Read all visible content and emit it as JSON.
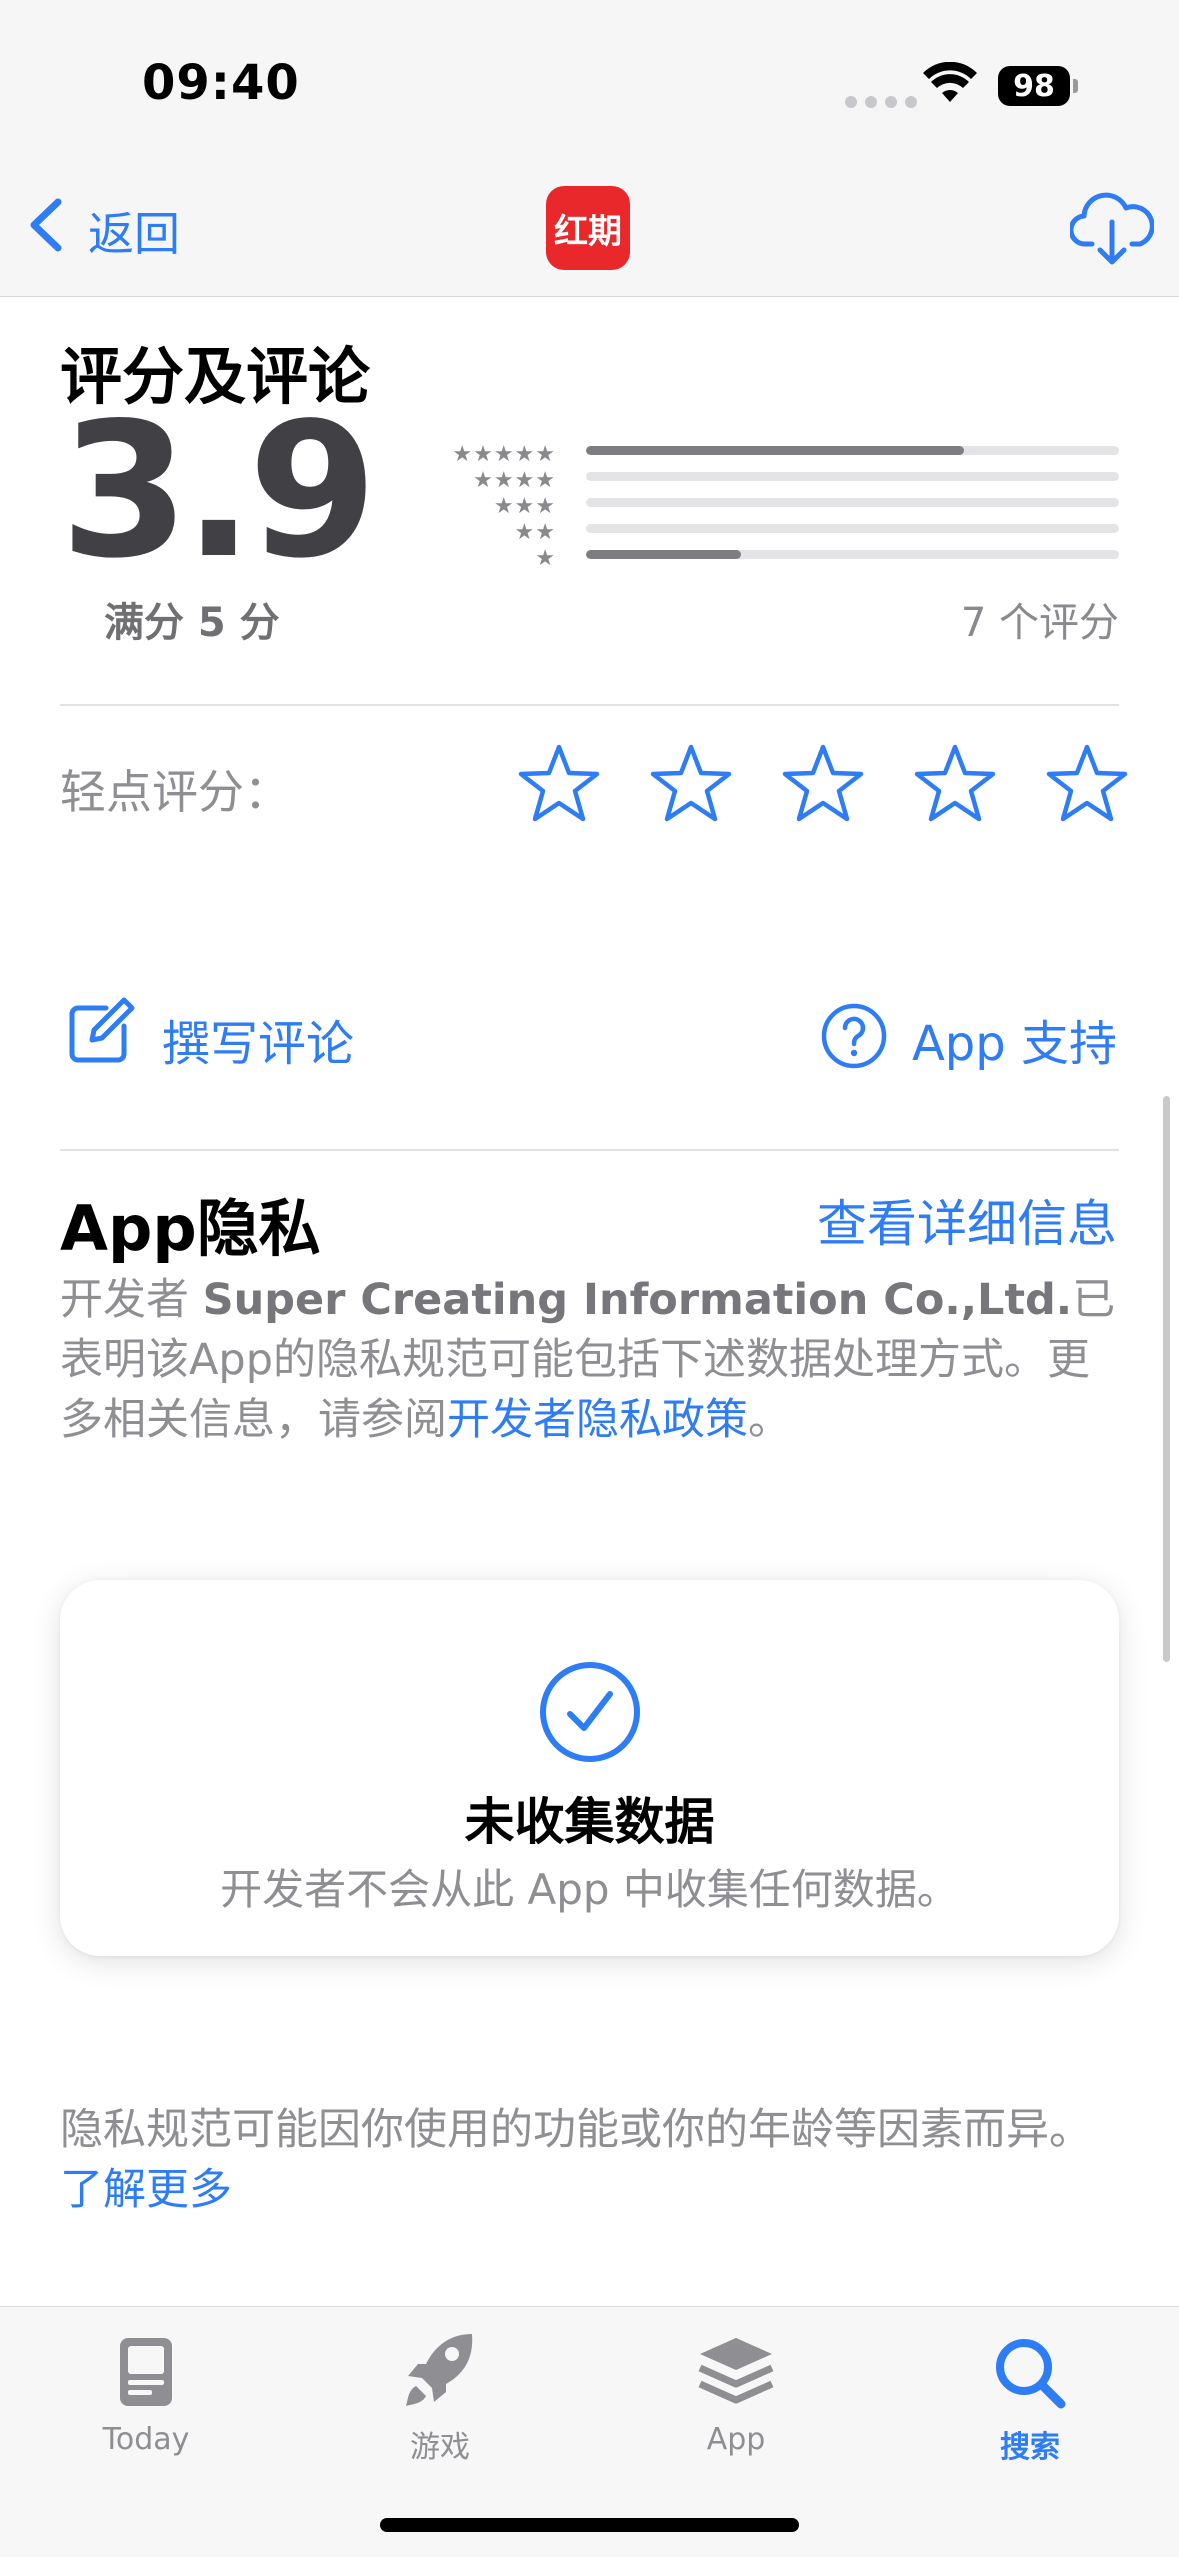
{
  "status": {
    "time": "09:40",
    "battery": "98"
  },
  "nav": {
    "back_label": "返回",
    "app_icon_text": "红期"
  },
  "ratings": {
    "title": "评分及评论",
    "score": "3.9",
    "out_of": "满分 5 分",
    "count": "7 个评分",
    "distribution": [
      {
        "stars": "★★★★★",
        "fraction": 0.71
      },
      {
        "stars": "★★★★",
        "fraction": 0.0
      },
      {
        "stars": "★★★",
        "fraction": 0.0
      },
      {
        "stars": "★★",
        "fraction": 0.0
      },
      {
        "stars": "★",
        "fraction": 0.29
      }
    ],
    "tap_label": "轻点评分："
  },
  "actions": {
    "write_review": "撰写评论",
    "app_support": "App 支持"
  },
  "privacy": {
    "title": "App隐私",
    "details_link": "查看详细信息",
    "desc_prefix": "开发者 ",
    "developer": "Super Creating Information Co.,Ltd.",
    "desc_middle": "已表明该App的隐私规范可能包括下述数据处理方式。更多相关信息，请参阅",
    "policy_link": "开发者隐私政策",
    "desc_end": "。",
    "card_title": "未收集数据",
    "card_subtitle": "开发者不会从此 App 中收集任何数据。",
    "footer_text": "隐私规范可能因你使用的功能或你的年龄等因素而异。",
    "learn_more": "了解更多"
  },
  "tabs": [
    {
      "label": "Today",
      "icon": "today-icon",
      "active": false
    },
    {
      "label": "游戏",
      "icon": "rocket-icon",
      "active": false
    },
    {
      "label": "App",
      "icon": "apps-stack-icon",
      "active": false
    },
    {
      "label": "搜索",
      "icon": "search-icon",
      "active": true
    }
  ],
  "colors": {
    "accent": "#2e7cf6",
    "app_icon": "#e8282a",
    "secondary_text": "#8e8e93"
  }
}
